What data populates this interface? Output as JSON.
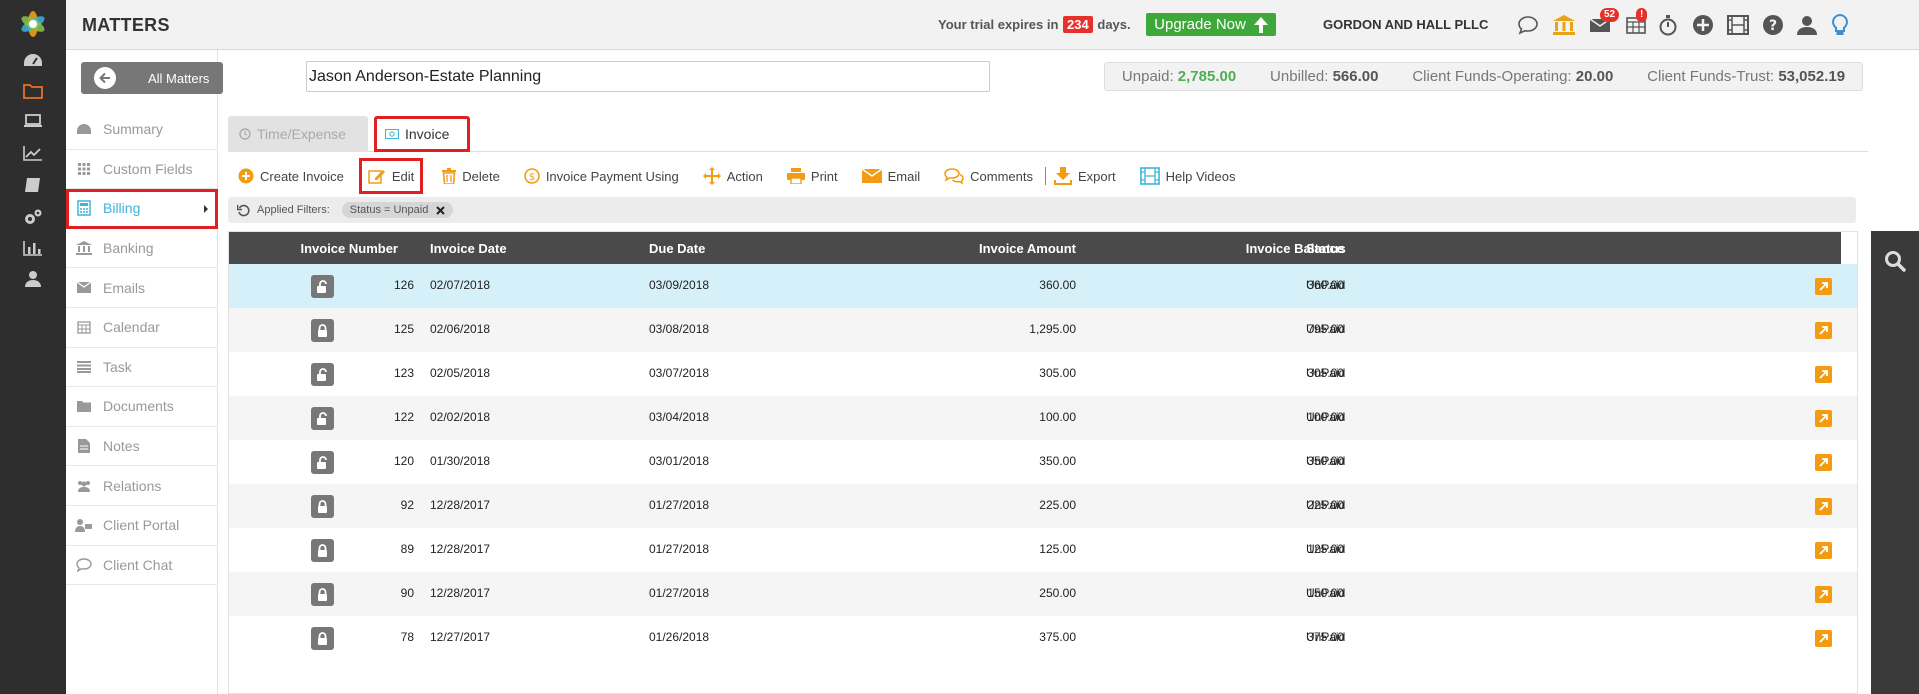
{
  "header": {
    "title": "MATTERS",
    "trial_prefix": "Your trial expires in",
    "trial_days": "234",
    "trial_suffix": "days.",
    "upgrade_label": "Upgrade Now",
    "firm_name": "GORDON AND HALL PLLC",
    "mail_count": "52",
    "calendar_alert": "!"
  },
  "matter": {
    "back_label": "All Matters",
    "name": "Jason Anderson-Estate Planning"
  },
  "balances": {
    "unpaid_label": "Unpaid:",
    "unpaid_value": "2,785.00",
    "unbilled_label": "Unbilled:",
    "unbilled_value": "566.00",
    "operating_label": "Client Funds-Operating:",
    "operating_value": "20.00",
    "trust_label": "Client Funds-Trust:",
    "trust_value": "53,052.19"
  },
  "sidebar": {
    "items": [
      {
        "label": "Summary",
        "icon": "dashboard-icon"
      },
      {
        "label": "Custom Fields",
        "icon": "grid-icon"
      },
      {
        "label": "Billing",
        "icon": "calculator-icon"
      },
      {
        "label": "Banking",
        "icon": "bank-icon"
      },
      {
        "label": "Emails",
        "icon": "envelope-icon"
      },
      {
        "label": "Calendar",
        "icon": "calendar-icon"
      },
      {
        "label": "Task",
        "icon": "task-list-icon"
      },
      {
        "label": "Documents",
        "icon": "folder-icon"
      },
      {
        "label": "Notes",
        "icon": "note-icon"
      },
      {
        "label": "Relations",
        "icon": "people-icon"
      },
      {
        "label": "Client Portal",
        "icon": "portal-icon"
      },
      {
        "label": "Client Chat",
        "icon": "chat-icon"
      }
    ]
  },
  "tabs": {
    "time_expense": "Time/Expense",
    "invoice": "Invoice"
  },
  "toolbar": {
    "create_invoice": "Create Invoice",
    "edit": "Edit",
    "delete": "Delete",
    "invoice_payment": "Invoice Payment Using",
    "action": "Action",
    "print": "Print",
    "email": "Email",
    "comments": "Comments",
    "export": "Export",
    "help_videos": "Help Videos"
  },
  "filters": {
    "label": "Applied Filters:",
    "chip": "Status = Unpaid"
  },
  "table": {
    "columns": {
      "invoice_number": "Invoice Number",
      "invoice_date": "Invoice Date",
      "due_date": "Due Date",
      "invoice_amount": "Invoice Amount",
      "invoice_balance": "Invoice Balance",
      "status": "Status"
    },
    "rows": [
      {
        "number": "126",
        "date": "02/07/2018",
        "due": "03/09/2018",
        "amount": "360.00",
        "balance": "360.00",
        "status": "UnPaid",
        "locked": false
      },
      {
        "number": "125",
        "date": "02/06/2018",
        "due": "03/08/2018",
        "amount": "1,295.00",
        "balance": "795.00",
        "status": "UnPaid",
        "locked": true
      },
      {
        "number": "123",
        "date": "02/05/2018",
        "due": "03/07/2018",
        "amount": "305.00",
        "balance": "305.00",
        "status": "UnPaid",
        "locked": false
      },
      {
        "number": "122",
        "date": "02/02/2018",
        "due": "03/04/2018",
        "amount": "100.00",
        "balance": "100.00",
        "status": "UnPaid",
        "locked": false
      },
      {
        "number": "120",
        "date": "01/30/2018",
        "due": "03/01/2018",
        "amount": "350.00",
        "balance": "350.00",
        "status": "UnPaid",
        "locked": false
      },
      {
        "number": "92",
        "date": "12/28/2017",
        "due": "01/27/2018",
        "amount": "225.00",
        "balance": "225.00",
        "status": "UnPaid",
        "locked": true
      },
      {
        "number": "89",
        "date": "12/28/2017",
        "due": "01/27/2018",
        "amount": "125.00",
        "balance": "125.00",
        "status": "UnPaid",
        "locked": true
      },
      {
        "number": "90",
        "date": "12/28/2017",
        "due": "01/27/2018",
        "amount": "250.00",
        "balance": "150.00",
        "status": "UnPaid",
        "locked": true
      },
      {
        "number": "78",
        "date": "12/27/2017",
        "due": "01/26/2018",
        "amount": "375.00",
        "balance": "375.00",
        "status": "UnPaid",
        "locked": true
      }
    ]
  },
  "colors": {
    "accent_blue": "#3db4dc",
    "orange": "#f39c12",
    "green": "#4caf50",
    "highlight_red": "#e02020"
  }
}
